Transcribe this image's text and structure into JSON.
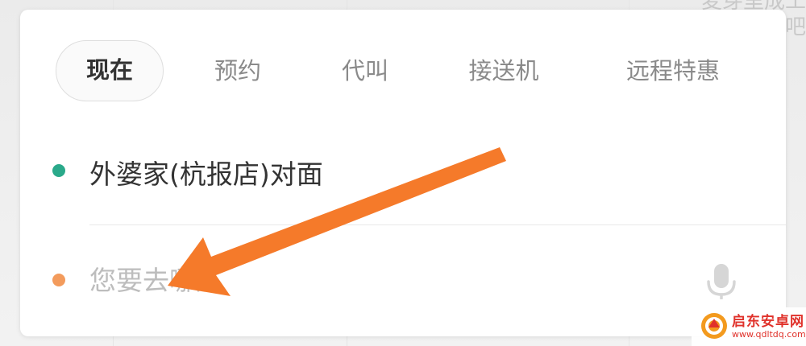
{
  "map": {
    "corner_text_line1": "麦芽里成工",
    "corner_text_line2": "吧"
  },
  "tabs": [
    {
      "label": "现在",
      "active": true
    },
    {
      "label": "预约",
      "active": false
    },
    {
      "label": "代叫",
      "active": false
    },
    {
      "label": "接送机",
      "active": false
    },
    {
      "label": "远程特惠",
      "active": false
    }
  ],
  "origin": {
    "text": "外婆家(杭报店)对面",
    "dot_color": "#2aa98a"
  },
  "destination": {
    "placeholder": "您要去哪儿",
    "value": "",
    "dot_color": "#f39b5c"
  },
  "icons": {
    "destination_voice": "microphone-icon"
  },
  "annotation": {
    "color": "#f57a2a"
  },
  "watermark": {
    "title": "启东安卓网",
    "url": "www.qdltdq.com"
  }
}
